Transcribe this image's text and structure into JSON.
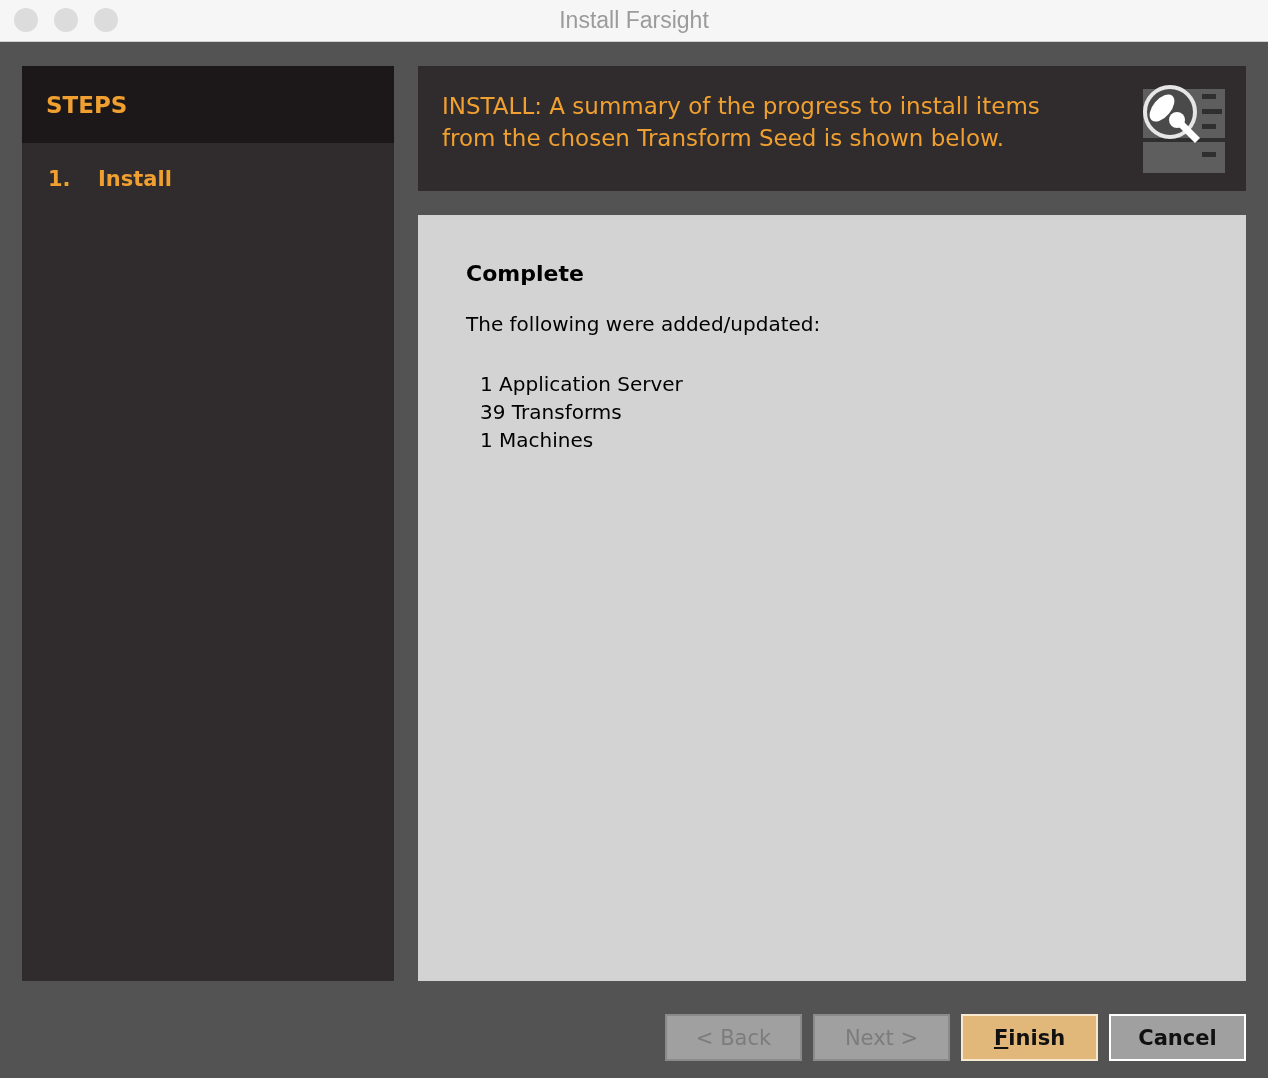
{
  "window": {
    "title": "Install Farsight"
  },
  "steps": {
    "title": "STEPS",
    "items": [
      {
        "number": "1.",
        "label": "Install",
        "selected": true
      }
    ]
  },
  "header": {
    "text": "INSTALL: A summary of the progress to install items from the chosen Transform Seed is shown below."
  },
  "content": {
    "heading": "Complete",
    "intro": "The following were added/updated:",
    "items": [
      "1 Application Server",
      "39 Transforms",
      "1 Machines"
    ]
  },
  "buttons": [
    {
      "label": "< Back",
      "disabled": true,
      "default": false,
      "mnemonic": false
    },
    {
      "label": "Next >",
      "disabled": true,
      "default": false,
      "mnemonic": false
    },
    {
      "label": "Finish",
      "disabled": false,
      "default": true,
      "mnemonic": true
    },
    {
      "label": "Cancel",
      "disabled": false,
      "default": false,
      "mnemonic": false
    }
  ]
}
